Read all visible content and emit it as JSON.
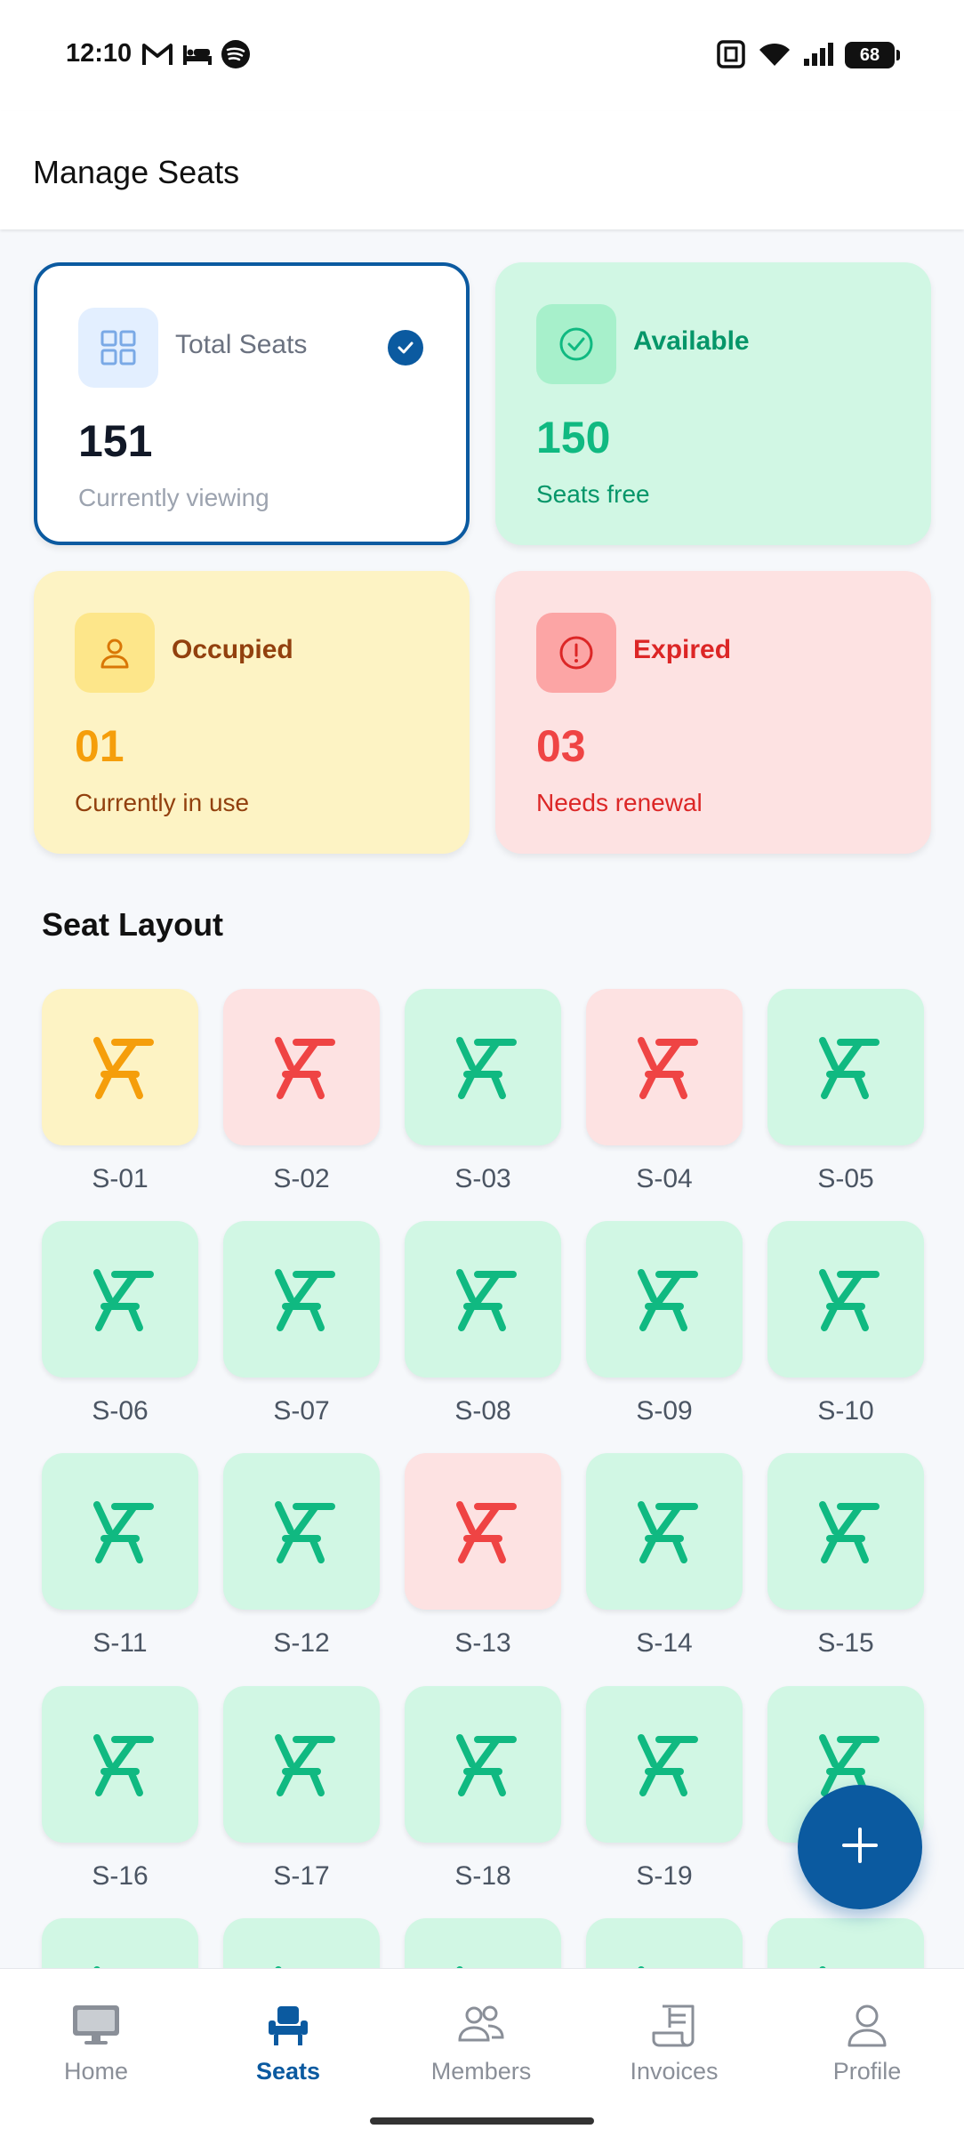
{
  "status_bar": {
    "time": "12:10",
    "battery": "68",
    "left_icons": [
      "gmail-icon",
      "bed-icon",
      "spotify-icon"
    ],
    "right_icons": [
      "nfc-icon",
      "wifi-icon",
      "signal-icon",
      "battery-icon"
    ]
  },
  "app_bar": {
    "title": "Manage Seats"
  },
  "stats": {
    "total": {
      "label": "Total Seats",
      "value": "151",
      "sub": "Currently viewing",
      "selected": true
    },
    "available": {
      "label": "Available",
      "value": "150",
      "sub": "Seats free"
    },
    "occupied": {
      "label": "Occupied",
      "value": "01",
      "sub": "Currently in use"
    },
    "expired": {
      "label": "Expired",
      "value": "03",
      "sub": "Needs renewal"
    }
  },
  "colors": {
    "primary": "#0b5aa0",
    "available_bg": "#d1f7e4",
    "available_fg": "#10b981",
    "occupied_bg": "#fdf3c4",
    "occupied_fg": "#f59e0b",
    "expired_bg": "#fde2e2",
    "expired_fg": "#ef4444"
  },
  "seat_layout": {
    "title": "Seat Layout",
    "seats": [
      {
        "id": "S-01",
        "status": "occupied"
      },
      {
        "id": "S-02",
        "status": "expired"
      },
      {
        "id": "S-03",
        "status": "available"
      },
      {
        "id": "S-04",
        "status": "expired"
      },
      {
        "id": "S-05",
        "status": "available"
      },
      {
        "id": "S-06",
        "status": "available"
      },
      {
        "id": "S-07",
        "status": "available"
      },
      {
        "id": "S-08",
        "status": "available"
      },
      {
        "id": "S-09",
        "status": "available"
      },
      {
        "id": "S-10",
        "status": "available"
      },
      {
        "id": "S-11",
        "status": "available"
      },
      {
        "id": "S-12",
        "status": "available"
      },
      {
        "id": "S-13",
        "status": "expired"
      },
      {
        "id": "S-14",
        "status": "available"
      },
      {
        "id": "S-15",
        "status": "available"
      },
      {
        "id": "S-16",
        "status": "available"
      },
      {
        "id": "S-17",
        "status": "available"
      },
      {
        "id": "S-18",
        "status": "available"
      },
      {
        "id": "S-19",
        "status": "available"
      },
      {
        "id": "",
        "status": "available"
      },
      {
        "id": "",
        "status": "available"
      },
      {
        "id": "",
        "status": "available"
      },
      {
        "id": "",
        "status": "available"
      },
      {
        "id": "",
        "status": "available"
      },
      {
        "id": "",
        "status": "available"
      }
    ]
  },
  "fab": {
    "icon": "plus-icon"
  },
  "bottom_nav": [
    {
      "label": "Home",
      "icon": "desktop-icon",
      "active": false
    },
    {
      "label": "Seats",
      "icon": "seat-icon",
      "active": true
    },
    {
      "label": "Members",
      "icon": "members-icon",
      "active": false
    },
    {
      "label": "Invoices",
      "icon": "invoice-icon",
      "active": false
    },
    {
      "label": "Profile",
      "icon": "profile-icon",
      "active": false
    }
  ]
}
